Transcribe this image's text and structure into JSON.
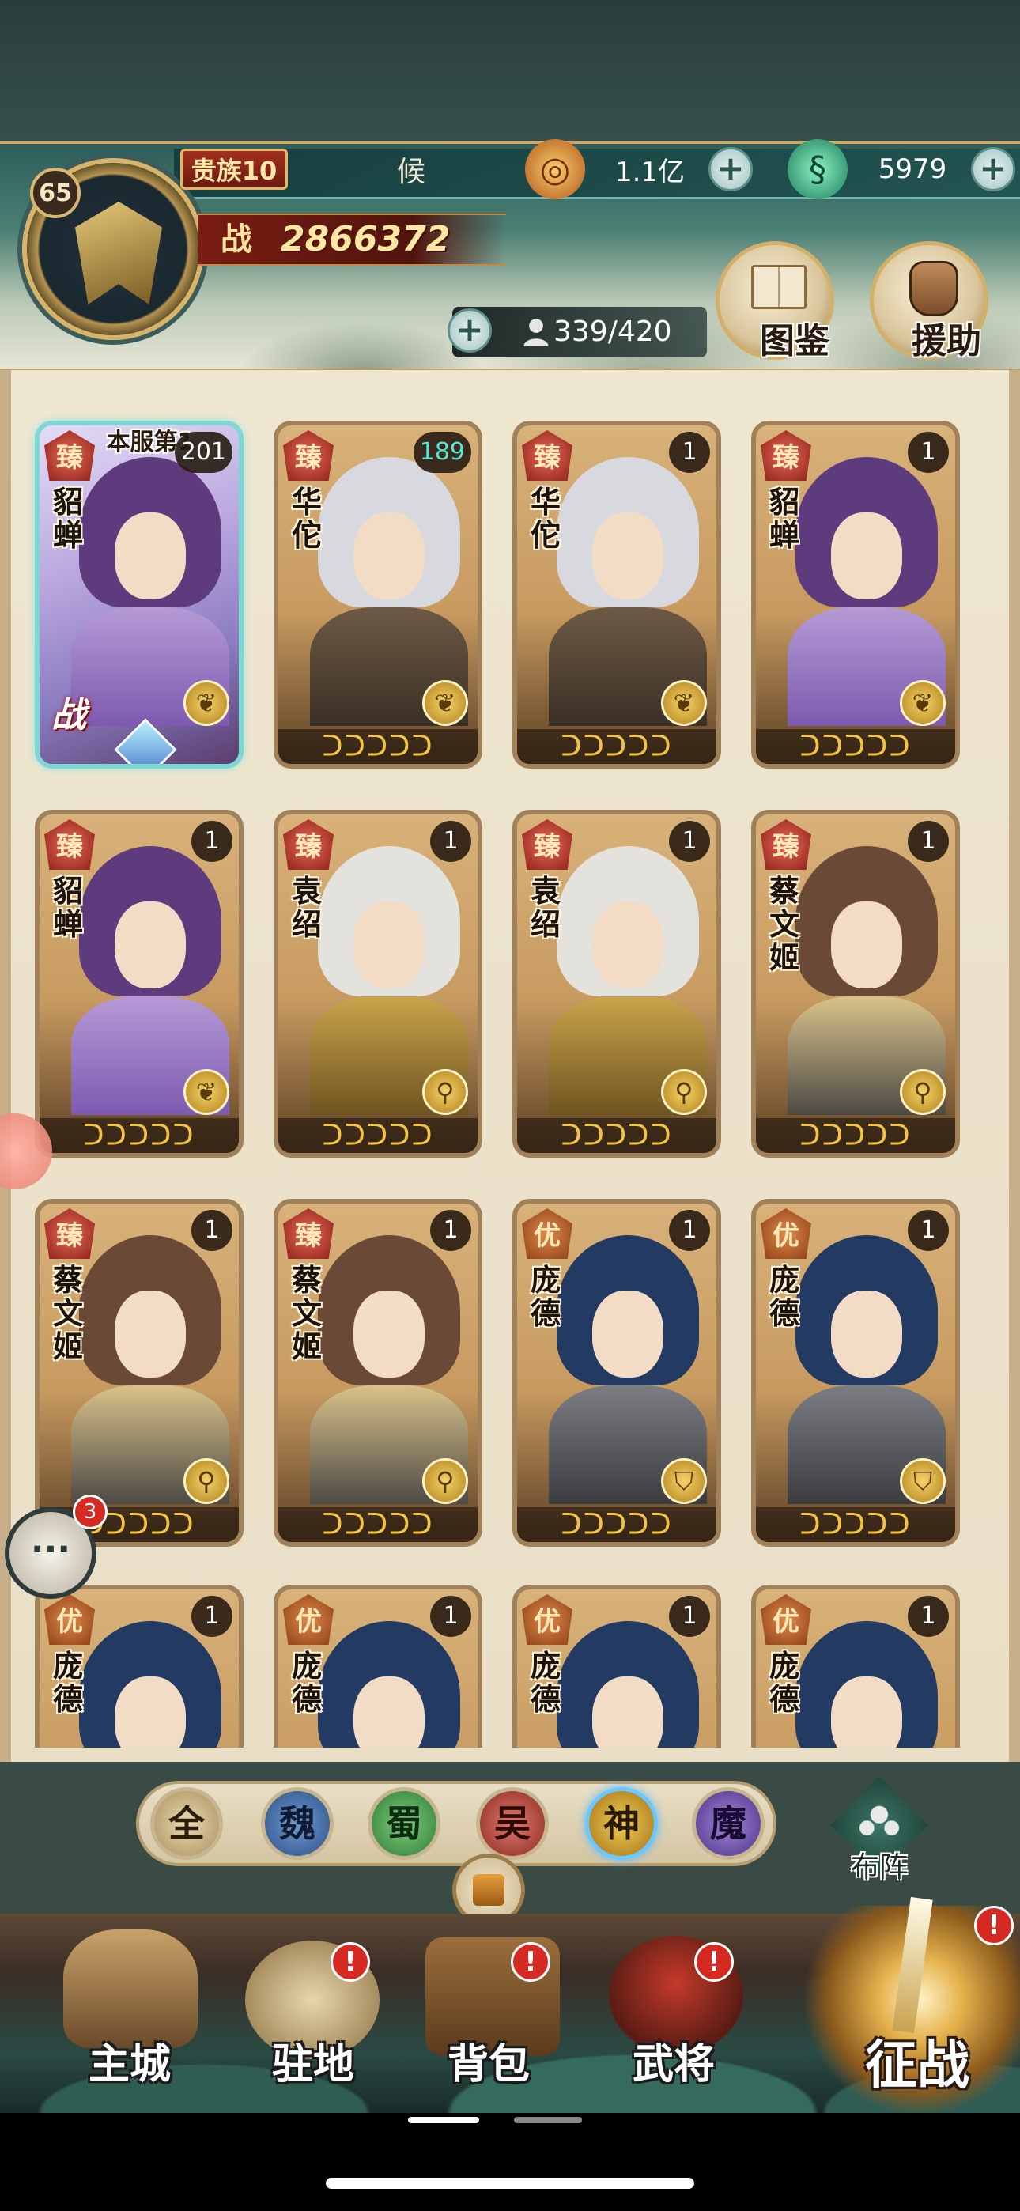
{
  "header": {
    "level": "65",
    "noble_rank": "贵族10",
    "title": "候",
    "gold_value": "1.1亿",
    "jade_value": "5979",
    "power_label": "战",
    "power_value": "2866372",
    "troops": "339/420",
    "atlas_label": "图鉴",
    "assist_label": "援助",
    "plus": "+"
  },
  "colors": {
    "accent_gold": "#d7b46a",
    "card_special_border": "#7fd7d5",
    "alert_red": "#d52a22",
    "quality_red": "#8d1e18"
  },
  "heroes": [
    {
      "name": "貂\n蝉",
      "quality": "臻",
      "count": "201",
      "banner": "本服第1",
      "battle": "战",
      "class_icon": "leaf-icon"
    },
    {
      "name": "华\n佗",
      "quality": "臻",
      "count": "189",
      "class_icon": "leaf-icon"
    },
    {
      "name": "华\n佗",
      "quality": "臻",
      "count": "1",
      "class_icon": "leaf-icon"
    },
    {
      "name": "貂\n蝉",
      "quality": "臻",
      "count": "1",
      "class_icon": "leaf-icon"
    },
    {
      "name": "貂\n蝉",
      "quality": "臻",
      "count": "1",
      "class_icon": "leaf-icon"
    },
    {
      "name": "袁\n绍",
      "quality": "臻",
      "count": "1",
      "class_icon": "staff-icon"
    },
    {
      "name": "袁\n绍",
      "quality": "臻",
      "count": "1",
      "class_icon": "staff-icon"
    },
    {
      "name": "蔡\n文\n姬",
      "quality": "臻",
      "count": "1",
      "class_icon": "staff-icon"
    },
    {
      "name": "蔡\n文\n姬",
      "quality": "臻",
      "count": "1",
      "class_icon": "staff-icon"
    },
    {
      "name": "蔡\n文\n姬",
      "quality": "臻",
      "count": "1",
      "class_icon": "staff-icon"
    },
    {
      "name": "庞\n德",
      "quality": "优",
      "count": "1",
      "class_icon": "shield-icon"
    },
    {
      "name": "庞\n德",
      "quality": "优",
      "count": "1",
      "class_icon": "shield-icon"
    },
    {
      "name": "庞\n德",
      "quality": "优",
      "count": "1"
    },
    {
      "name": "庞\n德",
      "quality": "优",
      "count": "1"
    },
    {
      "name": "庞\n德",
      "quality": "优",
      "count": "1"
    },
    {
      "name": "庞\n德",
      "quality": "优",
      "count": "1"
    }
  ],
  "star_glyphs": "ᑐᑐᑐᑐᑐ",
  "factions": {
    "all": "全",
    "wei": "魏",
    "shu": "蜀",
    "wu": "吴",
    "shen": "神",
    "mo": "魔",
    "selected": "神"
  },
  "formation_label": "布阵",
  "chat": {
    "badge": "3"
  },
  "nav": {
    "main": "主城",
    "garrison": "驻地",
    "bag": "背包",
    "general": "武将",
    "battle": "征战",
    "alert": "!"
  }
}
